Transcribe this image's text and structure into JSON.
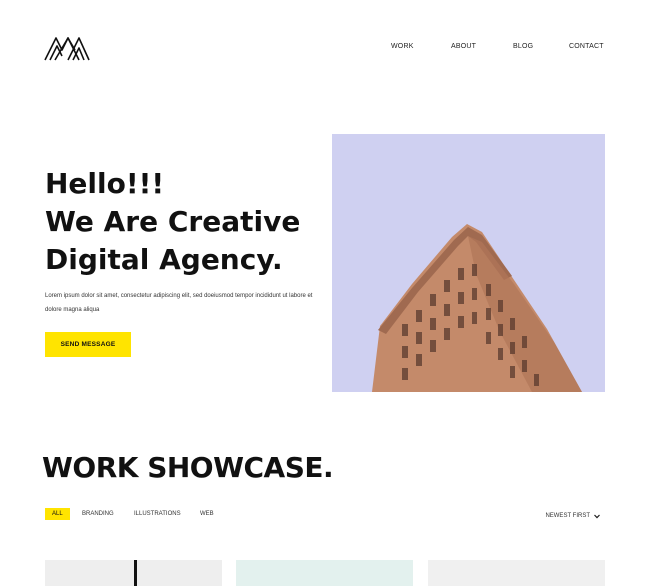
{
  "header": {
    "logo_icon": "mountain-m-logo",
    "nav": [
      "WORK",
      "ABOUT",
      "BLOG",
      "CONTACT"
    ]
  },
  "hero": {
    "title_lines": [
      "Hello!!!",
      "We Are Creative",
      "Digital Agency."
    ],
    "description": "Lorem ipsum dolor sit amet, consectetur adipiscing elit, sed doeiusmod tempor incididunt ut labore et dolore magna aliqua",
    "button_label": "SEND MESSAGE",
    "image_icon": "flatiron-building-photo"
  },
  "showcase": {
    "title": "WORK SHOWCASE.",
    "filters": [
      "ALL",
      "BRANDING",
      "ILLUSTRATIONS",
      "WEB"
    ],
    "sort_label": "NEWEST FIRST",
    "sort_icon": "chevron-down-icon"
  },
  "colors": {
    "accent": "#ffe400",
    "hero_sky": "#cfd0f1",
    "building": "#c48a6a",
    "card_grey": "#eeeeee",
    "card_mint": "#e3f1ee",
    "card_light": "#f0f0f0"
  }
}
